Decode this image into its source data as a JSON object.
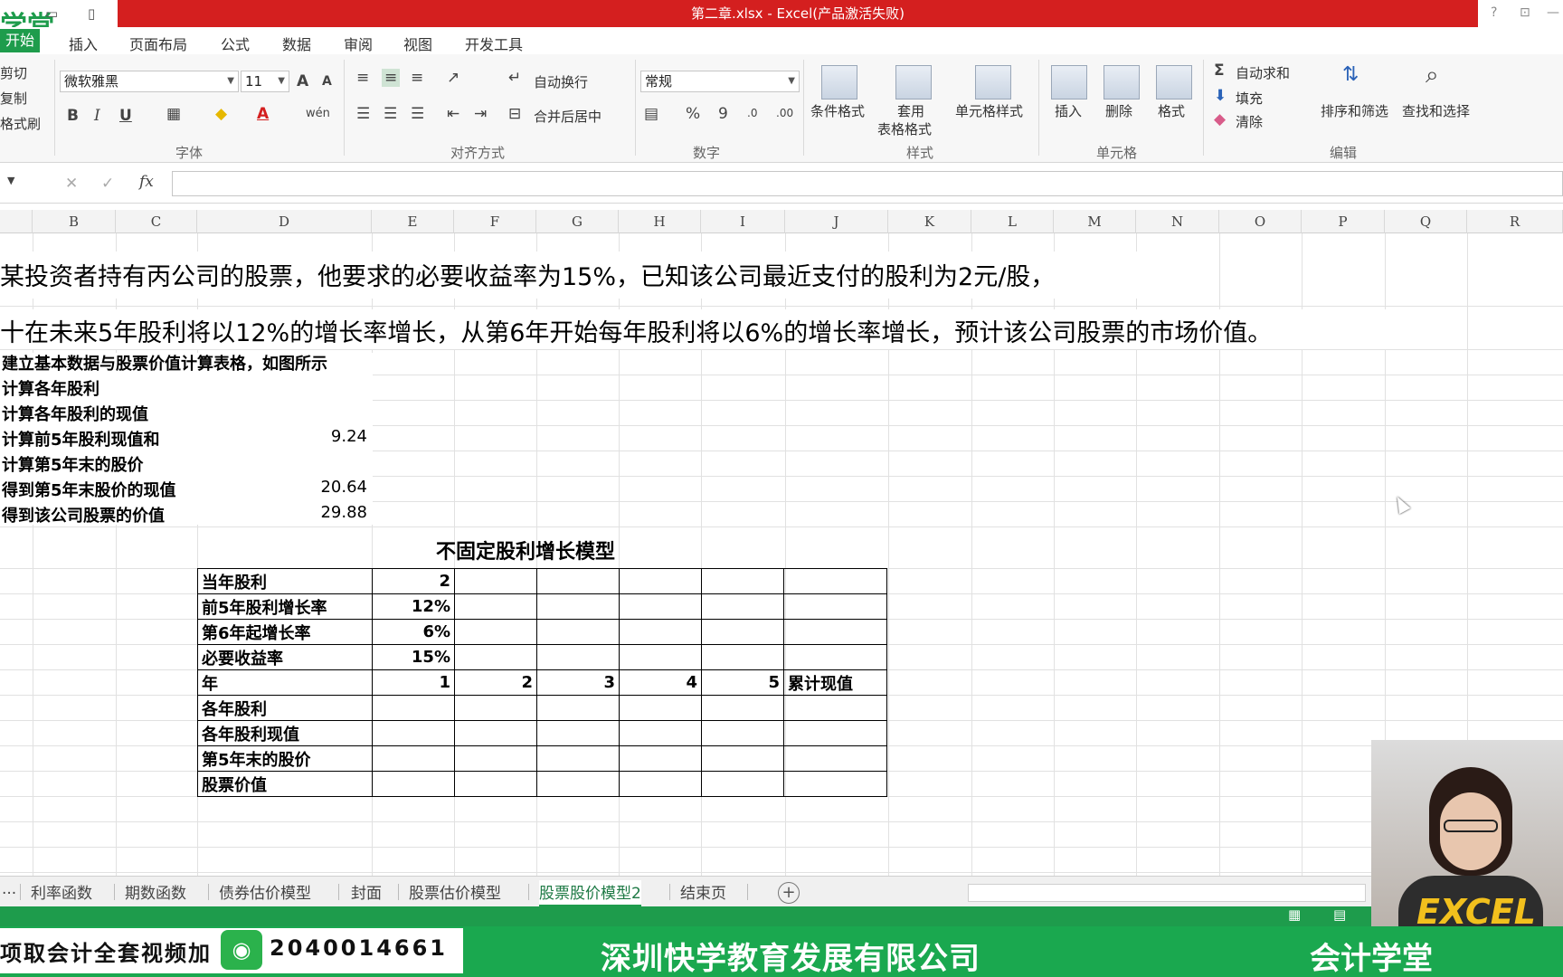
{
  "window": {
    "title": "第二章.xlsx -  Excel(产品激活失败)",
    "logo": "学堂",
    "ctl_help": "?",
    "ctl_restore": "⊡",
    "ctl_min": "—"
  },
  "menu": {
    "tabs": [
      "开始",
      "插入",
      "页面布局",
      "公式",
      "数据",
      "审阅",
      "视图",
      "开发工具"
    ]
  },
  "ribbon": {
    "clipboard": {
      "cut": "剪切",
      "copy": "复制",
      "format_painter": "格式刷"
    },
    "font": {
      "name": "微软雅黑",
      "size": "11",
      "label": "字体",
      "bold": "B",
      "italic": "I",
      "underline": "U",
      "grow": "A",
      "shrink": "A",
      "font_color": "A",
      "phonetic": "wén"
    },
    "alignment": {
      "wrap": "自动换行",
      "merge": "合并后居中",
      "label": "对齐方式"
    },
    "number": {
      "format": "常规",
      "percent": "%",
      "comma": "9",
      "inc_dec": ".0",
      "dec_dec": ".00",
      "label": "数字"
    },
    "styles": {
      "conditional": "条件格式",
      "table_1": "套用",
      "table_2": "表格格式",
      "cell_styles": "单元格样式",
      "label": "样式"
    },
    "cells": {
      "insert": "插入",
      "delete": "删除",
      "format": "格式",
      "label": "单元格"
    },
    "editing": {
      "autosum": "自动求和",
      "fill": "填充",
      "clear": "清除",
      "sort": "排序和筛选",
      "find": "查找和选择",
      "label": "编辑",
      "sigma": "Σ"
    }
  },
  "formula_bar": {
    "fx": "fx",
    "cancel": "✕",
    "enter": "✓",
    "value": ""
  },
  "columns": [
    "B",
    "C",
    "D",
    "E",
    "F",
    "G",
    "H",
    "I",
    "J",
    "K",
    "L",
    "M",
    "N",
    "O",
    "P",
    "Q",
    "R"
  ],
  "sheet": {
    "line1": "某投资者持有丙公司的股票，他要求的必要收益率为15%，已知该公司最近支付的股利为2元/股，",
    "line2": "十在未来5年股利将以12%的增长率增长，从第6年开始每年股利将以6%的增长率增长，预计该公司股票的市场价值。",
    "steps": [
      {
        "label": "建立基本数据与股票价值计算表格，如图所示",
        "value": ""
      },
      {
        "label": "计算各年股利",
        "value": ""
      },
      {
        "label": "计算各年股利的现值",
        "value": ""
      },
      {
        "label": "计算前5年股利现值和",
        "value": "9.24"
      },
      {
        "label": "计算第5年末的股价",
        "value": ""
      },
      {
        "label": "得到第5年末股价的现值",
        "value": "20.64"
      },
      {
        "label": "得到该公司股票的价值",
        "value": "29.88"
      }
    ],
    "table_title": "不固定股利增长模型",
    "table": [
      [
        "当年股利",
        "2",
        "",
        "",
        "",
        "",
        ""
      ],
      [
        "前5年股利增长率",
        "12%",
        "",
        "",
        "",
        "",
        ""
      ],
      [
        "第6年起增长率",
        "6%",
        "",
        "",
        "",
        "",
        ""
      ],
      [
        "必要收益率",
        "15%",
        "",
        "",
        "",
        "",
        ""
      ],
      [
        "年",
        "1",
        "2",
        "3",
        "4",
        "5",
        "累计现值"
      ],
      [
        "各年股利",
        "",
        "",
        "",
        "",
        "",
        ""
      ],
      [
        "各年股利现值",
        "",
        "",
        "",
        "",
        "",
        ""
      ],
      [
        "第5年末的股价",
        "",
        "",
        "",
        "",
        "",
        ""
      ],
      [
        "股票价值",
        "",
        "",
        "",
        "",
        "",
        ""
      ]
    ]
  },
  "sheet_tabs": {
    "items": [
      "...",
      "利率函数",
      "期数函数",
      "债券估价模型",
      "封面",
      "股票估价模型",
      "股票股价模型2",
      "结束页"
    ],
    "active_index": 6,
    "add": "+"
  },
  "banner": {
    "left_text": "项取会计全套视频加",
    "phone": "2040014661",
    "company": "深圳快学教育发展有限公司",
    "brand": "会计学堂"
  },
  "webcam": {
    "overlay_text": "EXCEL"
  }
}
